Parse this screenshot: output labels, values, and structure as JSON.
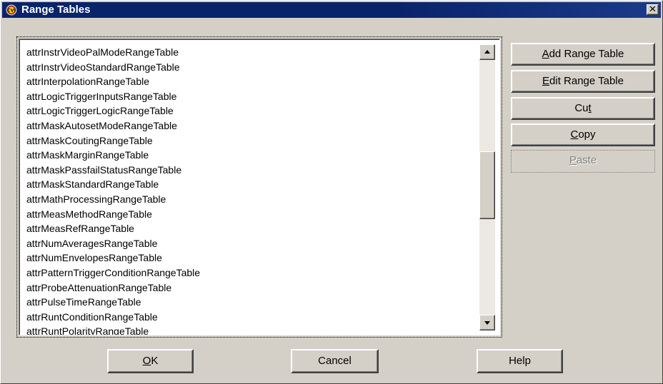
{
  "window": {
    "title": "Range Tables",
    "app_icon": "cvi-icon",
    "close_symbol": "✕"
  },
  "list": {
    "items": [
      "attrInstrVideoPalModeRangeTable",
      "attrInstrVideoStandardRangeTable",
      "attrInterpolationRangeTable",
      "attrLogicTriggerInputsRangeTable",
      "attrLogicTriggerLogicRangeTable",
      "attrMaskAutosetModeRangeTable",
      "attrMaskCoutingRangeTable",
      "attrMaskMarginRangeTable",
      "attrMaskPassfailStatusRangeTable",
      "attrMaskStandardRangeTable",
      "attrMathProcessingRangeTable",
      "attrMeasMethodRangeTable",
      "attrMeasRefRangeTable",
      "attrNumAveragesRangeTable",
      "attrNumEnvelopesRangeTable",
      "attrPatternTriggerConditionRangeTable",
      "attrProbeAttenuationRangeTable",
      "attrPulseTimeRangeTable",
      "attrRuntConditionRangeTable",
      "attrRuntPolarityRangeTable"
    ]
  },
  "side_buttons": {
    "add": {
      "mnemonic": "A",
      "rest": "dd Range Table"
    },
    "edit": {
      "mnemonic": "E",
      "rest": "dit Range Table"
    },
    "cut": {
      "before": "Cu",
      "mnemonic": "t",
      "after": ""
    },
    "copy": {
      "mnemonic": "C",
      "rest": "opy"
    },
    "paste": {
      "mnemonic": "P",
      "rest": "aste",
      "enabled": false
    }
  },
  "bottom_buttons": {
    "ok": {
      "mnemonic": "O",
      "rest": "K"
    },
    "cancel": "Cancel",
    "help": "Help"
  },
  "colors": {
    "titlebar": "#0a246a",
    "face": "#d4d0c8"
  }
}
